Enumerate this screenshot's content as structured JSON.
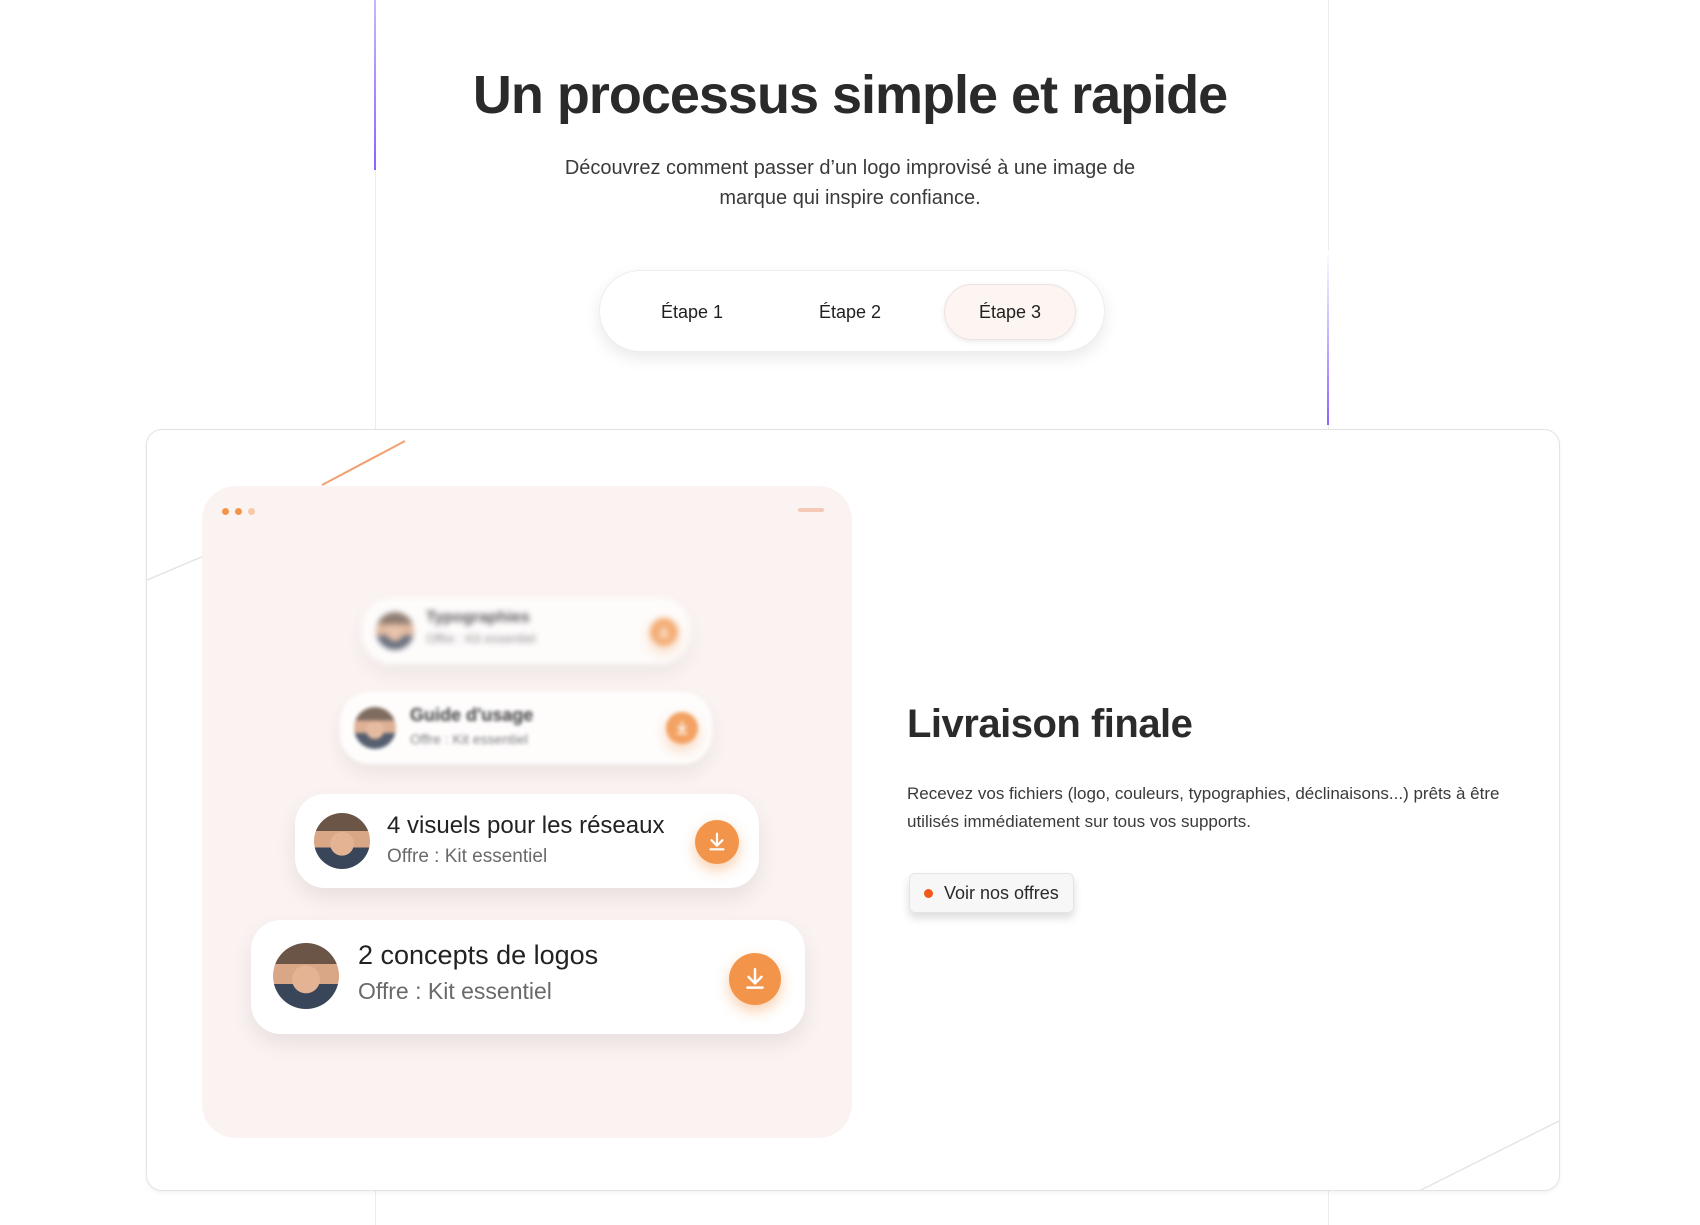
{
  "hero": {
    "title": "Un processus simple et rapide",
    "subtitle_line1": "Découvrez comment passer d’un logo improvisé à une image de",
    "subtitle_line2": "marque qui inspire confiance."
  },
  "steps": {
    "items": [
      {
        "label": "Étape 1",
        "active": false
      },
      {
        "label": "Étape 2",
        "active": false
      },
      {
        "label": "Étape 3",
        "active": true
      }
    ]
  },
  "deliverables": [
    {
      "name": "Typographies",
      "offer": "Offre : Kit essentiel",
      "icon": "download-icon"
    },
    {
      "name": "Guide d'usage",
      "offer": "Offre : Kit essentiel",
      "icon": "download-icon"
    },
    {
      "name": "4 visuels pour les réseaux",
      "offer": "Offre : Kit essentiel",
      "icon": "download-icon"
    },
    {
      "name": "2 concepts de logos",
      "offer": "Offre : Kit essentiel",
      "icon": "download-icon"
    }
  ],
  "panel": {
    "heading": "Livraison finale",
    "description": "Recevez vos fichiers (logo, couleurs, typographies, déclinaisons...) prêts à être utilisés immédiatement sur tous vos supports.",
    "cta_label": "Voir nos offres"
  },
  "colors": {
    "accent_orange": "#f2954b",
    "cta_bullet": "#f05a1a",
    "purple_line": "#8a63ff",
    "mock_bg": "#fbf3f1"
  }
}
